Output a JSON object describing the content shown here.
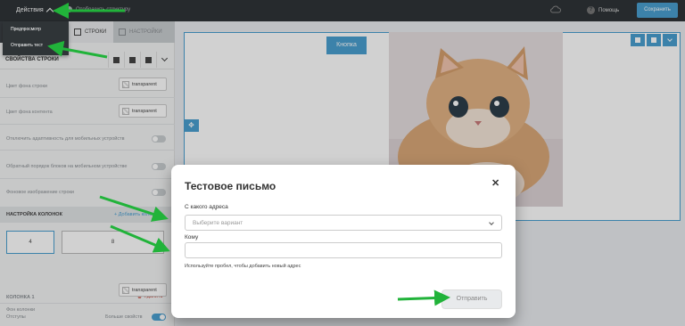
{
  "topbar": {
    "actions_label": "Действия",
    "structure_label": "Отобразить структуру",
    "help_label": "Помощь",
    "save_label": "Сохранить"
  },
  "actions_menu": {
    "items": [
      {
        "label": "Предпросмотр"
      },
      {
        "label": "Отправить тест"
      }
    ]
  },
  "sidebar": {
    "tabs": [
      {
        "label": "СТРОКИ",
        "active": true
      },
      {
        "label": "НАСТРОЙКИ",
        "active": false
      }
    ],
    "row_props_title": "СВОЙСТВА СТРОКИ",
    "row_bg_label": "Цвет фона строки",
    "row_bg_value": "transparent",
    "content_bg_label": "Цвет фона контента",
    "content_bg_value": "transparent",
    "disable_adaptive_label": "Отключить адаптивность для мобильных устройств",
    "reverse_order_label": "Обратный порядок блоков на мобильном устройстве",
    "bg_image_label": "Фоновое изображение строки",
    "columns_title": "НАСТРОЙКА КОЛОНОК",
    "add_column_label": "Добавить колонку",
    "columns": [
      {
        "value": "4",
        "selected": true
      },
      {
        "value": "8",
        "selected": false
      }
    ],
    "column1_title": "КОЛОНКА 1",
    "delete_label": "Удалить",
    "column_bg_label": "Фон колонки",
    "column_bg_value": "transparent",
    "padding_label": "Отступы",
    "more_props_label": "Больше свойств"
  },
  "canvas": {
    "button_label": "Кнопка"
  },
  "modal": {
    "title": "Тестовое письмо",
    "from_label": "С какого адреса",
    "from_placeholder": "Выберите вариант",
    "to_label": "Кому",
    "to_value": "",
    "hint": "Используйте пробел, чтобы добавить новый адрес",
    "send_label": "Отправить",
    "close_symbol": "✕"
  },
  "colors": {
    "accent": "#4a9fd0",
    "topbar": "#2f3437",
    "annotation": "#21b33a"
  },
  "icons": {
    "move": "✥"
  }
}
